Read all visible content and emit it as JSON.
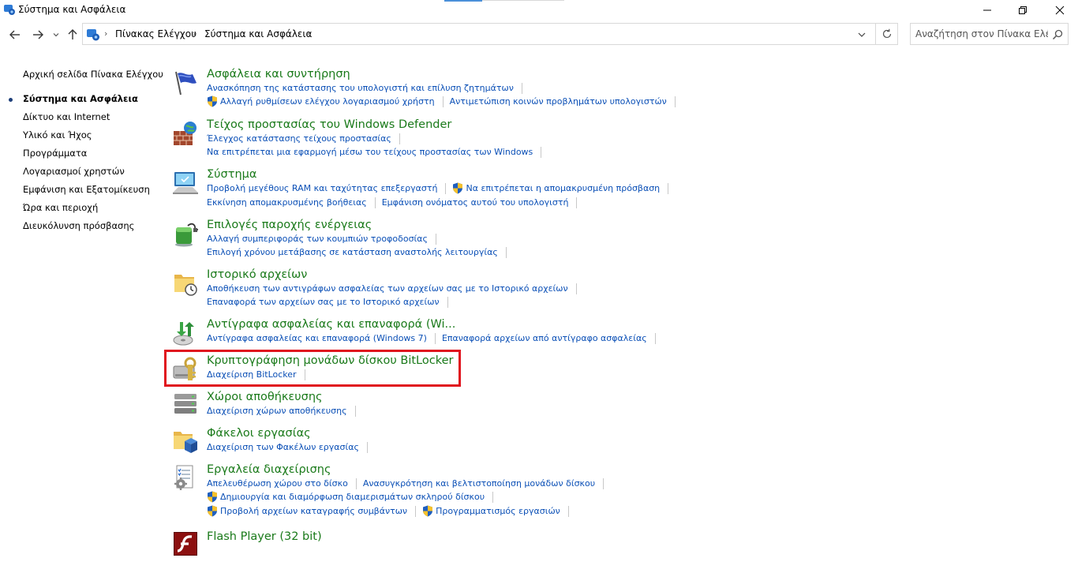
{
  "window": {
    "title": "Σύστημα και Ασφάλεια"
  },
  "breadcrumb": [
    "Πίνακας Ελέγχου",
    "Σύστημα και Ασφάλεια"
  ],
  "search": {
    "placeholder": "Αναζήτηση στον Πίνακα Ελέγ..."
  },
  "sidebar": {
    "items": [
      {
        "label": "Αρχική σελίδα Πίνακα Ελέγχου",
        "current": false
      },
      {
        "label": "Σύστημα και Ασφάλεια",
        "current": true
      },
      {
        "label": "Δίκτυο και Internet",
        "current": false
      },
      {
        "label": "Υλικό και Ήχος",
        "current": false
      },
      {
        "label": "Προγράμματα",
        "current": false
      },
      {
        "label": "Λογαριασμοί χρηστών",
        "current": false
      },
      {
        "label": "Εμφάνιση και Εξατομίκευση",
        "current": false
      },
      {
        "label": "Ώρα και περιοχή",
        "current": false
      },
      {
        "label": "Διευκόλυνση πρόσβασης",
        "current": false
      }
    ]
  },
  "categories": [
    {
      "title": "Ασφάλεια και συντήρηση",
      "icon": "flag-icon",
      "rows": [
        [
          {
            "text": "Ανασκόπηση της κατάστασης του υπολογιστή και επίλυση ζητημάτων",
            "shield": false
          }
        ],
        [
          {
            "text": "Αλλαγή ρυθμίσεων ελέγχου λογαριασμού χρήστη",
            "shield": true
          },
          {
            "text": "Αντιμετώπιση κοινών προβλημάτων υπολογιστών",
            "shield": false
          }
        ]
      ]
    },
    {
      "title": "Τείχος προστασίας του Windows Defender",
      "icon": "firewall-icon",
      "rows": [
        [
          {
            "text": "Έλεγχος κατάστασης τείχους προστασίας",
            "shield": false
          }
        ],
        [
          {
            "text": "Να επιτρέπεται μια εφαρμογή μέσω του τείχους προστασίας των Windows",
            "shield": false
          }
        ]
      ]
    },
    {
      "title": "Σύστημα",
      "icon": "computer-icon",
      "rows": [
        [
          {
            "text": "Προβολή μεγέθους RAM και ταχύτητας επεξεργαστή",
            "shield": false
          },
          {
            "text": "Να επιτρέπεται η απομακρυσμένη πρόσβαση",
            "shield": true
          }
        ],
        [
          {
            "text": "Εκκίνηση απομακρυσμένης βοήθειας",
            "shield": false
          },
          {
            "text": "Εμφάνιση ονόματος αυτού του υπολογιστή",
            "shield": false
          }
        ]
      ]
    },
    {
      "title": "Επιλογές παροχής ενέργειας",
      "icon": "battery-icon",
      "rows": [
        [
          {
            "text": "Αλλαγή συμπεριφοράς των κουμπιών τροφοδοσίας",
            "shield": false
          }
        ],
        [
          {
            "text": "Επιλογή χρόνου μετάβασης σε κατάσταση αναστολής λειτουργίας",
            "shield": false
          }
        ]
      ]
    },
    {
      "title": "Ιστορικό αρχείων",
      "icon": "file-history-icon",
      "rows": [
        [
          {
            "text": "Αποθήκευση των αντιγράφων ασφαλείας των αρχείων σας με το Ιστορικό αρχείων",
            "shield": false
          }
        ],
        [
          {
            "text": "Επαναφορά των αρχείων σας με το Ιστορικό αρχείων",
            "shield": false
          }
        ]
      ]
    },
    {
      "title": "Αντίγραφα ασφαλείας και επαναφορά (Wi...",
      "icon": "backup-icon",
      "rows": [
        [
          {
            "text": "Αντίγραφα ασφαλείας και επαναφορά (Windows 7)",
            "shield": false
          },
          {
            "text": "Επαναφορά αρχείων από αντίγραφο ασφαλείας",
            "shield": false
          }
        ]
      ]
    },
    {
      "title": "Κρυπτογράφηση μονάδων δίσκου BitLocker",
      "icon": "bitlocker-icon",
      "rows": [
        [
          {
            "text": "Διαχείριση BitLocker",
            "shield": false
          }
        ]
      ]
    },
    {
      "title": "Χώροι αποθήκευσης",
      "icon": "storage-spaces-icon",
      "rows": [
        [
          {
            "text": "Διαχείριση χώρων αποθήκευσης",
            "shield": false
          }
        ]
      ]
    },
    {
      "title": "Φάκελοι εργασίας",
      "icon": "work-folders-icon",
      "rows": [
        [
          {
            "text": "Διαχείριση των Φακέλων εργασίας",
            "shield": false
          }
        ]
      ]
    },
    {
      "title": "Εργαλεία διαχείρισης",
      "icon": "admin-tools-icon",
      "rows": [
        [
          {
            "text": "Απελευθέρωση χώρου στο δίσκο",
            "shield": false
          },
          {
            "text": "Ανασυγκρότηση και βελτιστοποίηση μονάδων δίσκου",
            "shield": false
          }
        ],
        [
          {
            "text": "Δημιουργία και διαμόρφωση διαμερισμάτων σκληρού δίσκου",
            "shield": true
          }
        ],
        [
          {
            "text": "Προβολή αρχείων καταγραφής συμβάντων",
            "shield": true
          },
          {
            "text": "Προγραμματισμός εργασιών",
            "shield": true
          }
        ]
      ]
    },
    {
      "title": "Flash Player (32 bit)",
      "icon": "flash-icon",
      "rows": []
    }
  ]
}
